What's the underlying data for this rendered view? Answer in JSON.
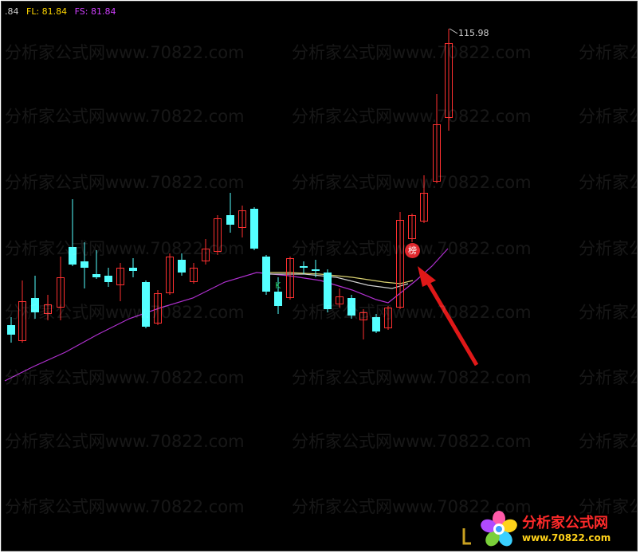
{
  "header": {
    "partial_value": ".84",
    "fl_label": "FL: 81.84",
    "fs_label": "FS: 81.84",
    "fl_color": "#ffd700",
    "fs_color": "#d040ff",
    "partial_color": "#cfcfcf"
  },
  "chart": {
    "peak_label": "115.98",
    "badge_text": "榜",
    "k_label": "K",
    "up_color": "#ff3030",
    "down_color": "#54ffff",
    "ma_purple_color": "#b030d0",
    "ma_yellow_color": "#d8d070",
    "ma_white_color": "#cfcfcf",
    "arrow_color": "#e01818"
  },
  "watermark": {
    "text": "分析家公式网www.70822.com"
  },
  "logo": {
    "title": "分析家公式网",
    "url": "www.70822.com"
  }
}
